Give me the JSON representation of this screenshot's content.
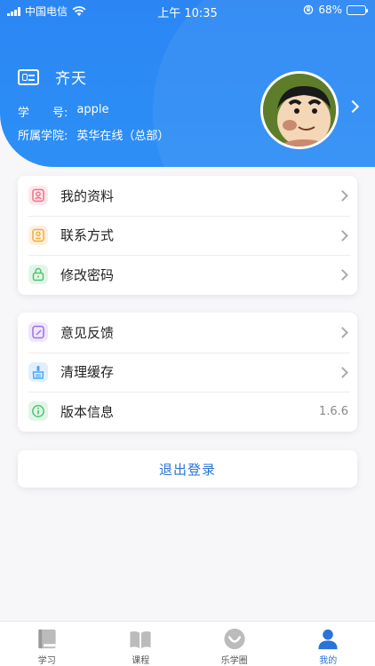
{
  "status_bar": {
    "carrier": "中国电信",
    "time": "上午 10:35",
    "battery": "68%",
    "battery_level": 0.68
  },
  "profile": {
    "name": "齐天",
    "student_id_label": "学　　号:",
    "student_id": "apple",
    "college_label": "所属学院:",
    "college": "英华在线（总部）"
  },
  "menu_group1": [
    {
      "label": "我的资料",
      "icon": "profile-icon",
      "color": "#ef6f86"
    },
    {
      "label": "联系方式",
      "icon": "contact-icon",
      "color": "#f5a93b"
    },
    {
      "label": "修改密码",
      "icon": "lock-icon",
      "color": "#4dc471"
    }
  ],
  "menu_group2": [
    {
      "label": "意见反馈",
      "icon": "feedback-icon",
      "color": "#9b6fe8"
    },
    {
      "label": "清理缓存",
      "icon": "broom-icon",
      "color": "#4ba6f5"
    },
    {
      "label": "版本信息",
      "icon": "info-icon",
      "color": "#4dc471",
      "value": "1.6.6"
    }
  ],
  "logout_label": "退出登录",
  "tabs": [
    {
      "label": "学习",
      "icon": "book-icon"
    },
    {
      "label": "课程",
      "icon": "open-book-icon"
    },
    {
      "label": "乐学圈",
      "icon": "smile-icon"
    },
    {
      "label": "我的",
      "icon": "user-icon",
      "active": true
    }
  ],
  "colors": {
    "header_blue": "#2d8ff6",
    "accent": "#2a73d8"
  }
}
